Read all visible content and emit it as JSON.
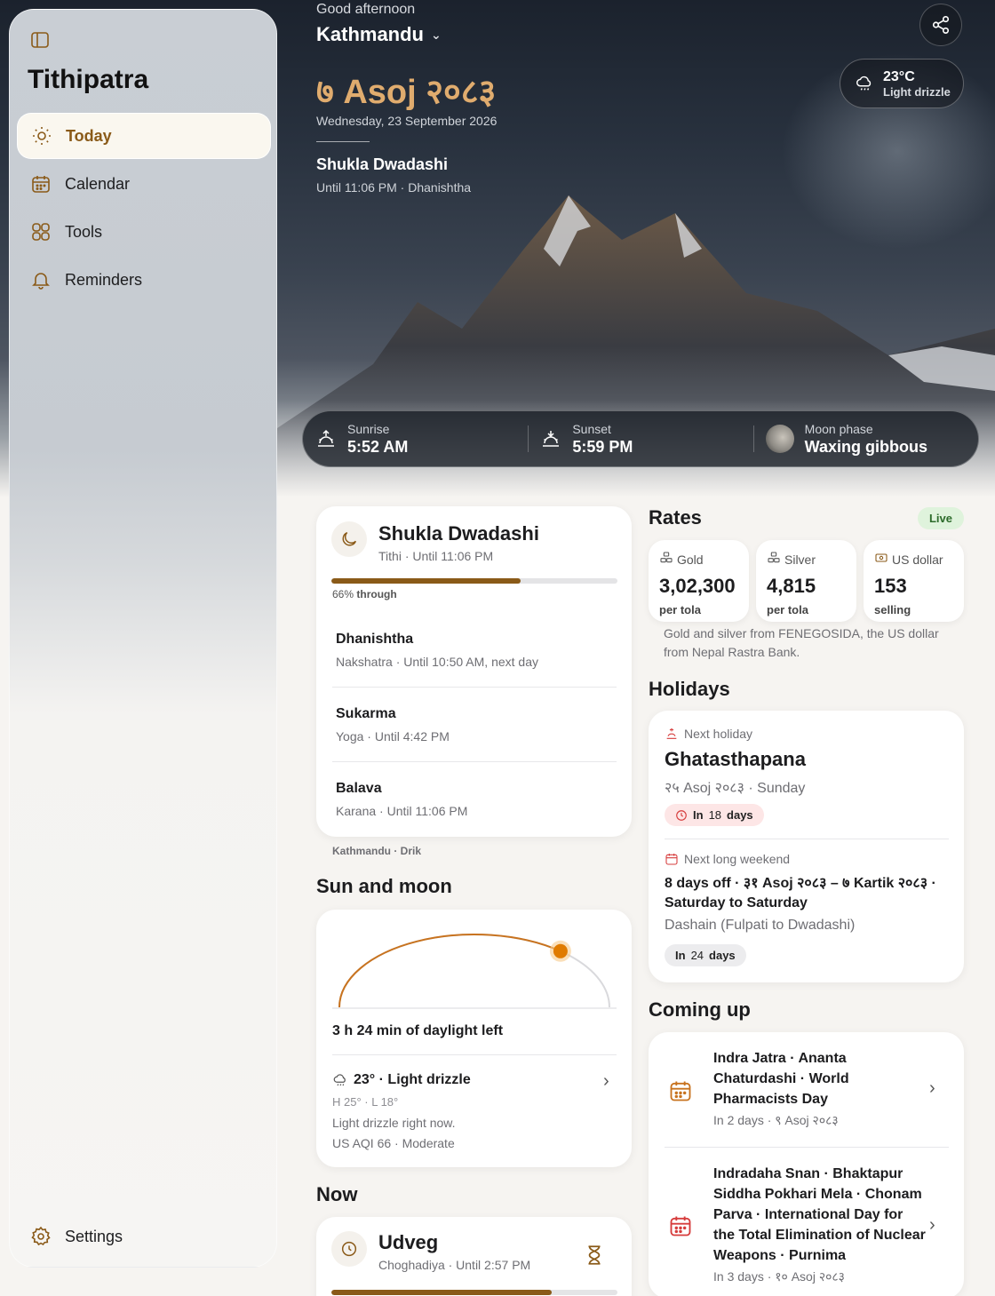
{
  "app": {
    "title": "Tithipatra"
  },
  "sidebar": {
    "items": [
      {
        "label": "Today",
        "icon": "sun-icon",
        "active": true
      },
      {
        "label": "Calendar",
        "icon": "calendar-icon"
      },
      {
        "label": "Tools",
        "icon": "grid-icon"
      },
      {
        "label": "Reminders",
        "icon": "bell-icon"
      }
    ],
    "settings_label": "Settings"
  },
  "hero": {
    "greeting": "Good afternoon",
    "city": "Kathmandu",
    "nepali_date": "७ Asoj २०८३",
    "english_date": "Wednesday, 23 September 2026",
    "tithi": "Shukla Dwadashi",
    "tithi_sub": "Until 11:06 PM · Dhanishtha",
    "weather": {
      "temp": "23°C",
      "condition": "Light drizzle"
    }
  },
  "astro": {
    "sunrise": {
      "label": "Sunrise",
      "value": "5:52 AM"
    },
    "sunset": {
      "label": "Sunset",
      "value": "5:59 PM"
    },
    "moon": {
      "label": "Moon phase",
      "value": "Waxing gibbous"
    }
  },
  "panchang": {
    "tithi_title": "Shukla Dwadashi",
    "tithi_sub": "Tithi · Until 11:06 PM",
    "progress_fraction": 0.66,
    "progress_pct": "66%",
    "progress_suffix": "through",
    "rows": [
      {
        "title": "Dhanishtha",
        "sub": "Nakshatra · Until 10:50 AM, next day"
      },
      {
        "title": "Sukarma",
        "sub": "Yoga · Until 4:42 PM"
      },
      {
        "title": "Balava",
        "sub": "Karana · Until 11:06 PM"
      }
    ],
    "footer": "Kathmandu · Drik"
  },
  "sun_moon": {
    "title": "Sun and moon",
    "daylight": "3 h 24 min of daylight left",
    "day_fraction": 0.72,
    "weather_line": "23° · Light drizzle",
    "hi_lo": "H 25° · L 18°",
    "note": "Light drizzle right now.",
    "aqi": "US AQI 66 · Moderate"
  },
  "now": {
    "title": "Now",
    "name": "Udveg",
    "sub": "Choghadiya · Until 2:57 PM",
    "progress_fraction": 0.77
  },
  "rates": {
    "title": "Rates",
    "badge": "Live",
    "items": [
      {
        "label": "Gold",
        "value": "3,02,300",
        "unit": "per tola"
      },
      {
        "label": "Silver",
        "value": "4,815",
        "unit": "per tola"
      },
      {
        "label": "US dollar",
        "value": "153",
        "unit": "selling"
      }
    ],
    "note": "Gold and silver from FENEGOSIDA, the US dollar from Nepal Rastra Bank."
  },
  "holidays": {
    "title": "Holidays",
    "next_label": "Next holiday",
    "next_name": "Ghatasthapana",
    "next_date": "२५ Asoj २०८३ · Sunday",
    "next_in_prefix": "In",
    "next_in_num": "18",
    "next_in_unit": "days",
    "weekend_label": "Next long weekend",
    "weekend_title": "8 days off · ३१ Asoj २०८३ – ७ Kartik २०८३ · Saturday to Saturday",
    "weekend_sub": "Dashain (Fulpati to Dwadashi)",
    "weekend_in_prefix": "In",
    "weekend_in_num": "24",
    "weekend_in_unit": "days"
  },
  "coming_up": {
    "title": "Coming up",
    "items": [
      {
        "title": "Indra Jatra · Ananta Chaturdashi · World Pharmacists Day",
        "sub": "In 2 days · ९ Asoj २०८३",
        "icon_color": "#c8731f"
      },
      {
        "title": "Indradaha Snan · Bhaktapur Siddha Pokhari Mela · Chonam Parva · International Day for the Total Elimination of Nuclear Weapons · Purnima",
        "sub": "In 3 days · १० Asoj २०८३",
        "icon_color": "#d63c3c"
      }
    ]
  },
  "colors": {
    "accent": "#8a5a18",
    "hero_date": "#e0ac6e",
    "sun": "#e07b00",
    "live": "#2c6b2a"
  }
}
